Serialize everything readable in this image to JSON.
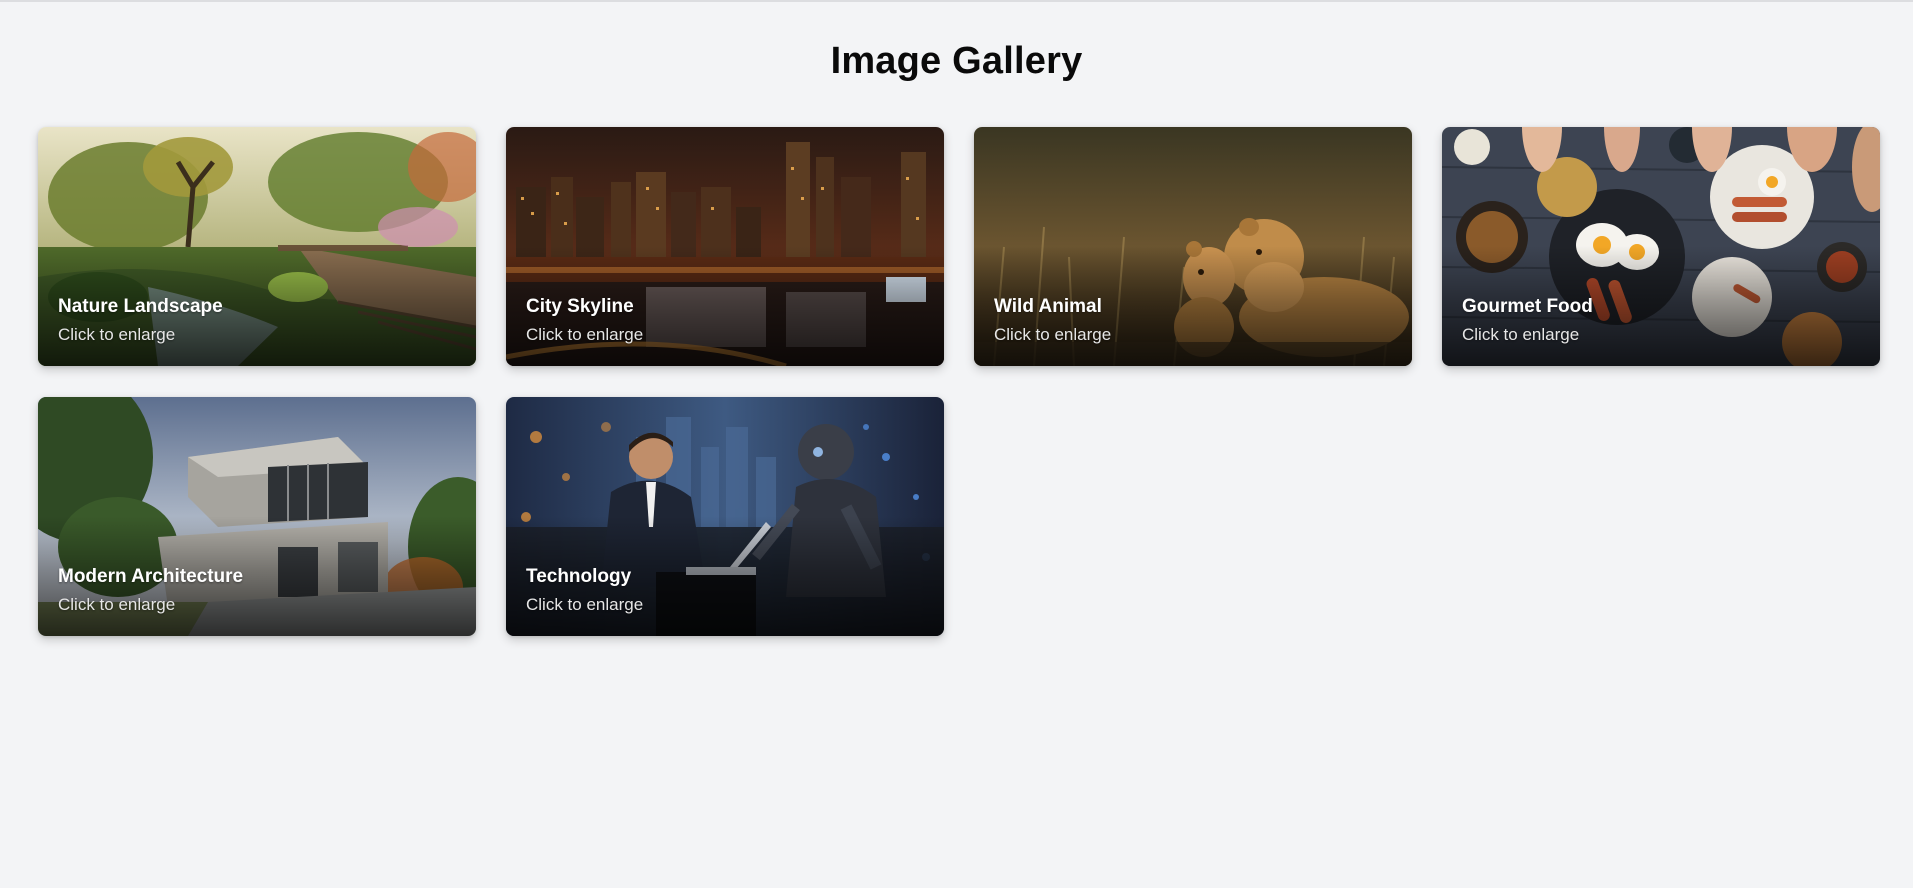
{
  "page": {
    "title": "Image Gallery",
    "background": "#f3f4f6"
  },
  "gallery": {
    "items": [
      {
        "title": "Nature Landscape",
        "subtitle": "Click to enlarge",
        "image": "forest-garden-photo"
      },
      {
        "title": "City Skyline",
        "subtitle": "Click to enlarge",
        "image": "night-city-photo"
      },
      {
        "title": "Wild Animal",
        "subtitle": "Click to enlarge",
        "image": "lions-photo"
      },
      {
        "title": "Gourmet Food",
        "subtitle": "Click to enlarge",
        "image": "breakfast-table-photo"
      },
      {
        "title": "Modern Architecture",
        "subtitle": "Click to enlarge",
        "image": "modern-house-photo"
      },
      {
        "title": "Technology",
        "subtitle": "Click to enlarge",
        "image": "man-and-robot-photo"
      }
    ]
  }
}
